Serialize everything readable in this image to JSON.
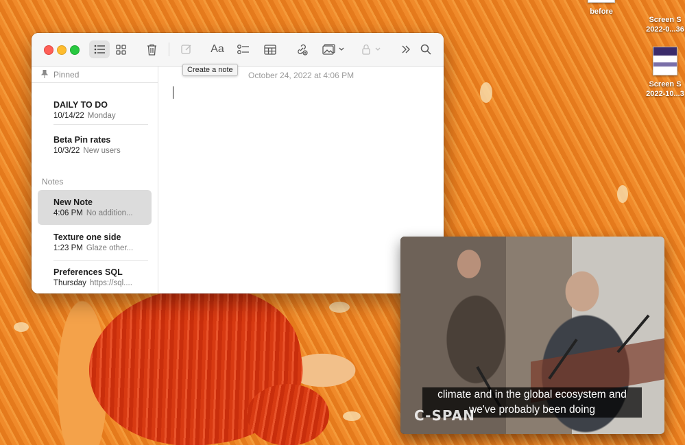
{
  "desktop": {
    "icons": [
      {
        "label": "before",
        "label2": ""
      },
      {
        "label": "Screen S",
        "label2": "2022-0...36"
      },
      {
        "label": "Screen S",
        "label2": "2022-10...3"
      }
    ]
  },
  "notes_window": {
    "toolbar": {
      "buttons": [
        {
          "icon": "list-view-icon",
          "state": "active"
        },
        {
          "icon": "gallery-view-icon"
        },
        {
          "icon": "trash-icon"
        },
        {
          "icon": "compose-icon",
          "state": "disabled"
        },
        {
          "icon": "format-text-icon",
          "label": "Aa"
        },
        {
          "icon": "checklist-icon"
        },
        {
          "icon": "table-icon"
        },
        {
          "icon": "link-attach-icon"
        },
        {
          "icon": "media-icon"
        },
        {
          "icon": "lock-icon",
          "state": "disabled"
        },
        {
          "icon": "more-chevrons-icon"
        },
        {
          "icon": "search-icon"
        }
      ],
      "tooltip": "Create a note"
    },
    "sidebar": {
      "pinned_label": "Pinned",
      "notes_label": "Notes",
      "pinned": [
        {
          "title": "DAILY TO DO",
          "date": "10/14/22",
          "preview": "Monday"
        },
        {
          "title": "Beta Pin rates",
          "date": "10/3/22",
          "preview": "New users"
        }
      ],
      "notes": [
        {
          "title": "New Note",
          "date": "4:06 PM",
          "preview": "No addition...",
          "selected": true
        },
        {
          "title": "Texture one side",
          "date": "1:23 PM",
          "preview": "Glaze other..."
        },
        {
          "title": "Preferences SQL",
          "date": "Thursday",
          "preview": "https://sql...."
        }
      ]
    },
    "editor": {
      "date_line": "October 24, 2022 at 4:06 PM"
    }
  },
  "video_pip": {
    "caption_line1": "climate and in the global ecosystem and",
    "caption_line2": "we've probably been doing",
    "channel_logo": "C-SPAN"
  },
  "colors": {
    "traffic_red": "#fe5f57",
    "traffic_yellow": "#febc2e",
    "traffic_green": "#28c840",
    "selected_row": "#dcdcdc"
  }
}
